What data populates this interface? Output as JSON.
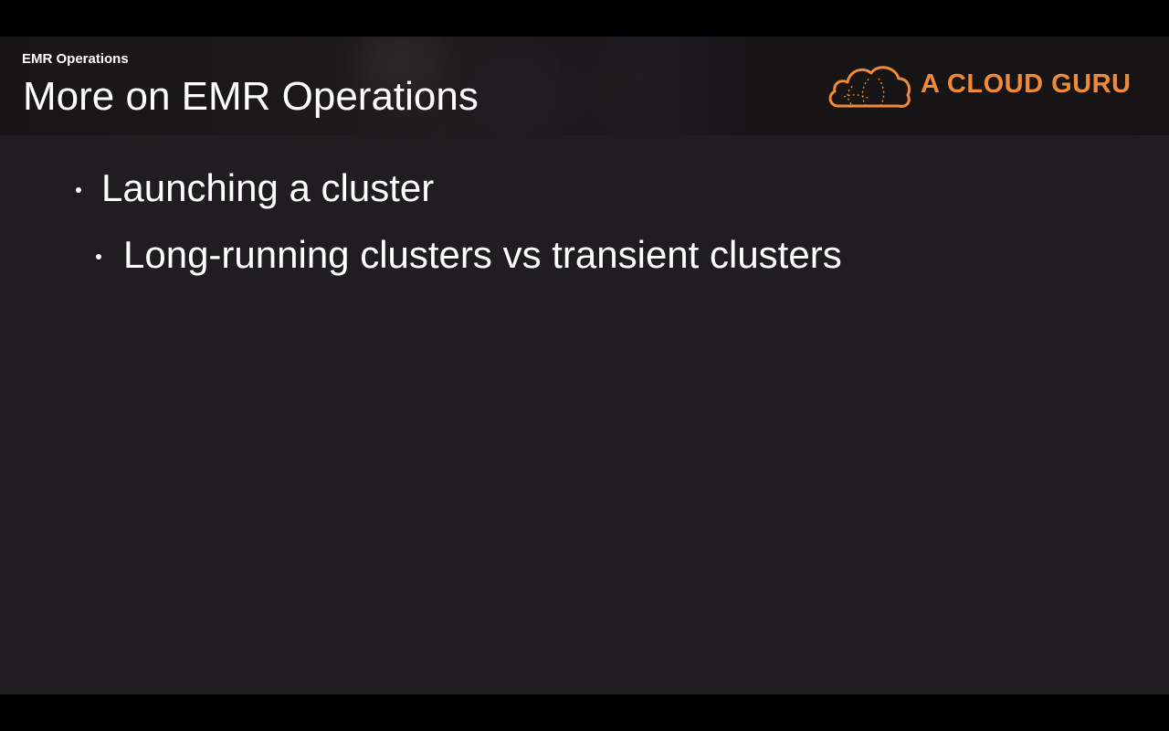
{
  "header": {
    "section_label": "EMR Operations",
    "title": "More on EMR Operations"
  },
  "brand": {
    "name": "A CLOUD GURU",
    "logo_icon": "cloud-logo-icon",
    "accent_color": "#f08a37"
  },
  "bullets": [
    {
      "level": 1,
      "text": "Launching a cluster"
    },
    {
      "level": 2,
      "text": "Long-running clusters vs transient clusters"
    }
  ],
  "colors": {
    "slide_background": "#1f1d20",
    "text": "#ffffff",
    "letterbox": "#000000"
  }
}
